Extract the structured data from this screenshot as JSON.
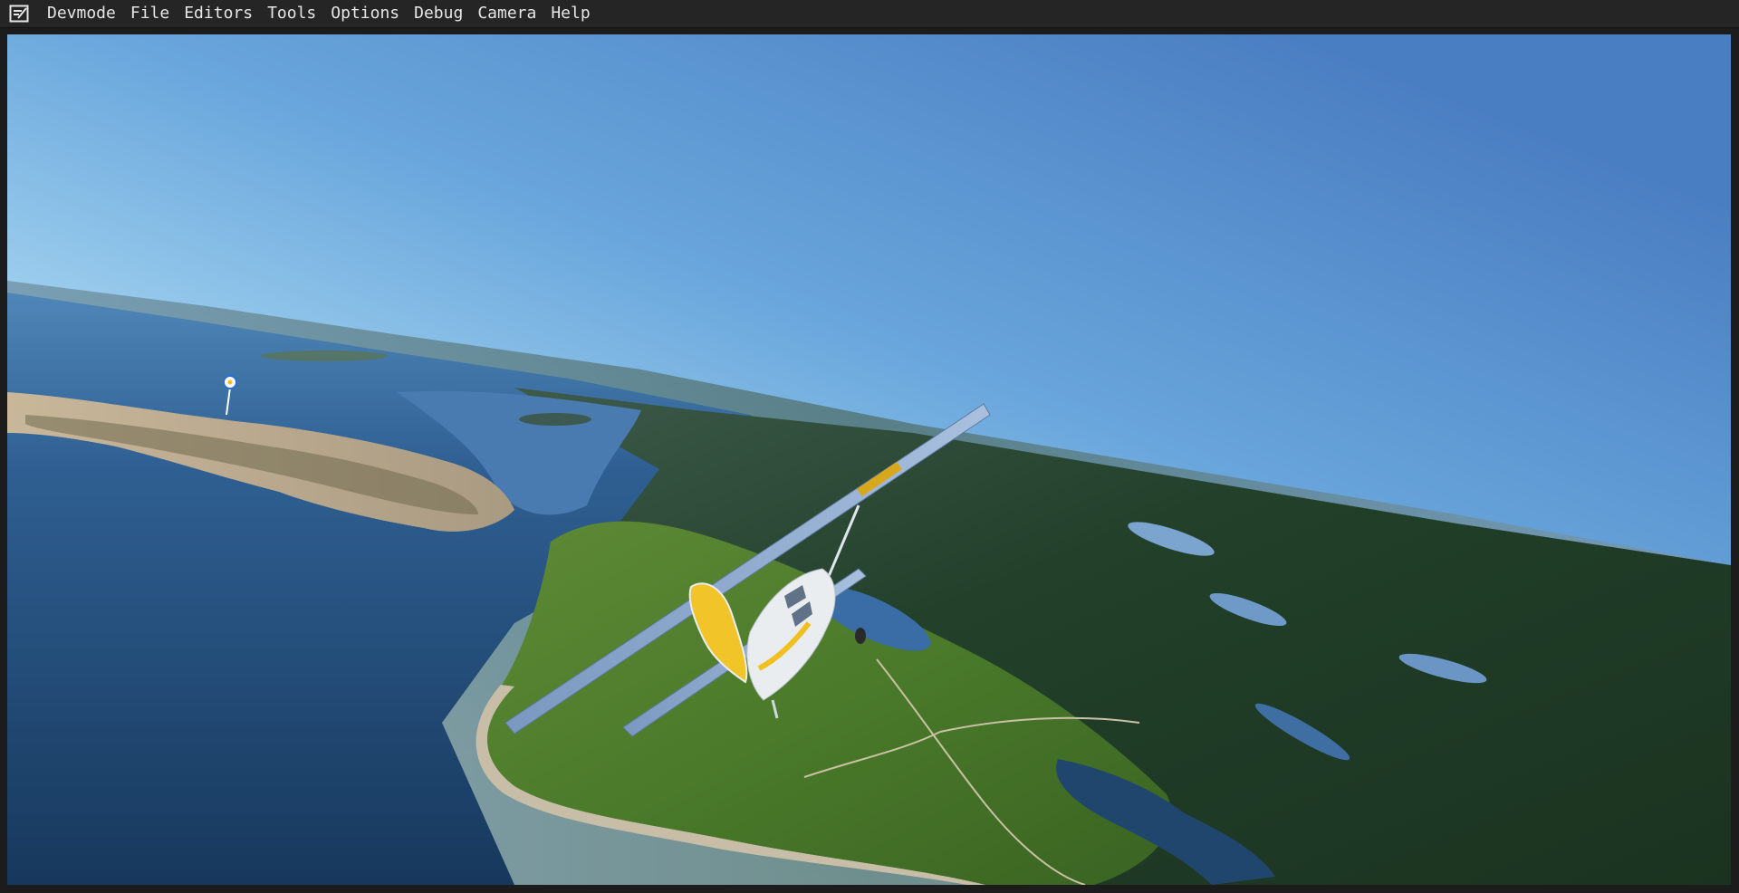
{
  "menubar": {
    "app_icon": "devmode-notepad-icon",
    "items": [
      {
        "label": "Devmode"
      },
      {
        "label": "File"
      },
      {
        "label": "Editors"
      },
      {
        "label": "Tools"
      },
      {
        "label": "Options"
      },
      {
        "label": "Debug"
      },
      {
        "label": "Camera"
      },
      {
        "label": "Help"
      }
    ]
  },
  "viewport": {
    "scene": "aircraft-flying-over-coastline",
    "waypoint_marker": "waypoint-pin-icon",
    "colors": {
      "sky_top": "#3f73b6",
      "sky_horizon": "#cde8f4",
      "water": "#1f4a78",
      "forest": "#1f3a22",
      "grass": "#4f7a2c",
      "plane_body": "#e8ecef",
      "plane_accent": "#f0c020"
    }
  }
}
